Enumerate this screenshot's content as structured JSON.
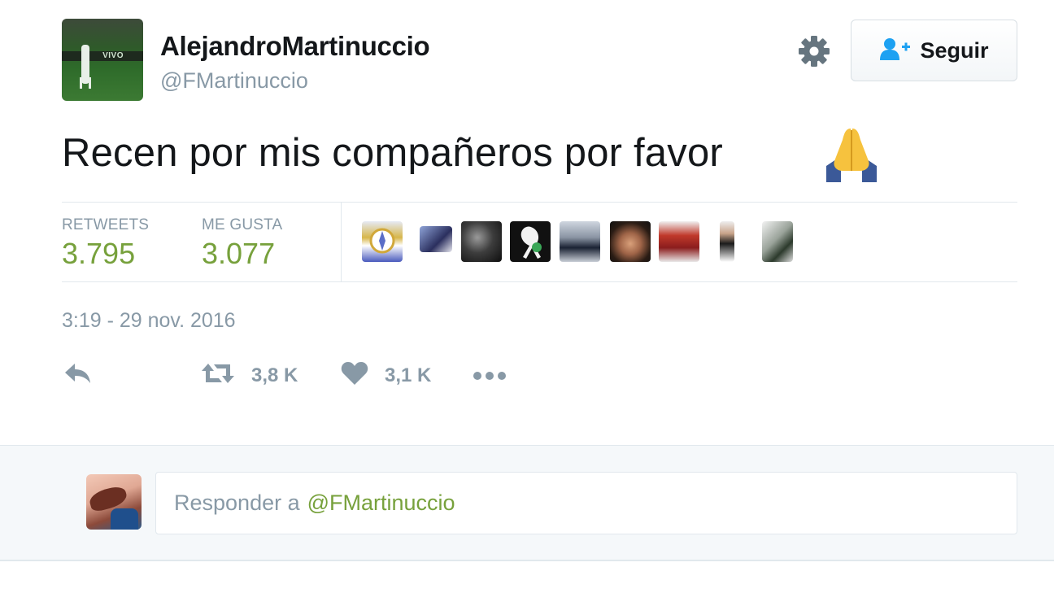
{
  "user": {
    "display_name": "AlejandroMartinuccio",
    "handle": "@FMartinuccio",
    "avatar_banner_text": "VIVO"
  },
  "header": {
    "follow_label": "Seguir",
    "settings_icon": "gear-icon",
    "follow_icon": "add-user-icon"
  },
  "tweet": {
    "text": "Recen por mis compañeros por favor",
    "emoji": "folded-hands"
  },
  "stats": {
    "retweets_label": "RETWEETS",
    "retweets_value": "3.795",
    "likes_label": "ME GUSTA",
    "likes_value": "3.077"
  },
  "likers": [
    {
      "name": "liker-avatar-1"
    },
    {
      "name": "liker-avatar-2"
    },
    {
      "name": "liker-avatar-3"
    },
    {
      "name": "liker-avatar-4"
    },
    {
      "name": "liker-avatar-5"
    },
    {
      "name": "liker-avatar-6"
    },
    {
      "name": "liker-avatar-7"
    },
    {
      "name": "liker-avatar-8"
    },
    {
      "name": "liker-avatar-9"
    }
  ],
  "timestamp": "3:19 - 29 nov. 2016",
  "actions": {
    "reply_icon": "reply-icon",
    "retweet_icon": "retweet-icon",
    "retweet_count": "3,8 K",
    "like_icon": "heart-icon",
    "like_count": "3,1 K",
    "more_icon": "more-icon"
  },
  "reply": {
    "placeholder_prefix": "Responder a",
    "placeholder_mention": "@FMartinuccio"
  },
  "colors": {
    "accent_green": "#77a13c",
    "muted_gray": "#8899a6",
    "follow_icon_blue": "#1da1f2"
  }
}
